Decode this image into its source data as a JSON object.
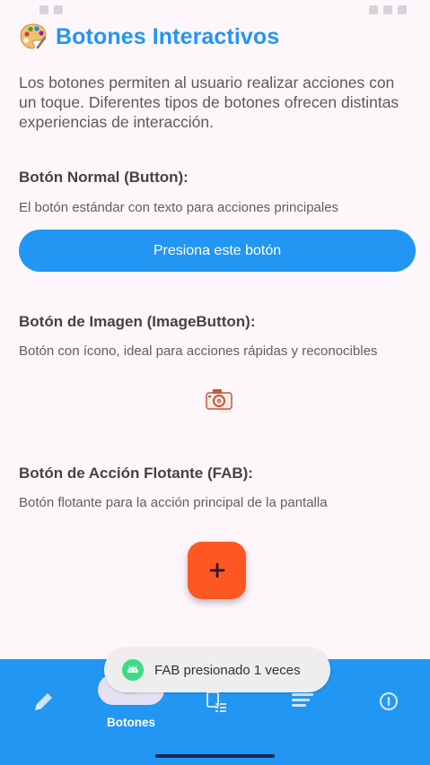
{
  "header": {
    "title": "Botones Interactivos"
  },
  "intro": "Los botones permiten al usuario realizar acciones con un toque. Diferentes tipos de botones ofrecen distintas experiencias de interacción.",
  "sections": {
    "normal": {
      "title": "Botón Normal (Button):",
      "description": "El botón estándar con texto para acciones principales",
      "button_label": "Presiona este botón"
    },
    "image": {
      "title": "Botón de Imagen (ImageButton):",
      "description": "Botón con ícono, ideal para acciones rápidas y reconocibles",
      "icon": "camera-icon"
    },
    "fab": {
      "title": "Botón de Acción Flotante (FAB):",
      "description": "Botón flotante para la acción principal de la pantalla",
      "icon": "plus-icon",
      "color": "#ff5722"
    }
  },
  "toast": {
    "text": "FAB presionado 1 veces",
    "icon": "android-icon"
  },
  "bottom_nav": {
    "items": [
      {
        "icon": "pencil-icon"
      },
      {
        "icon": "button-icon",
        "label": "Botones",
        "selected": true
      },
      {
        "icon": "list-doc-icon"
      },
      {
        "icon": "lines-icon"
      },
      {
        "icon": "info-icon"
      }
    ]
  },
  "colors": {
    "accent": "#2196f3",
    "background": "#fdf6fb",
    "fab": "#ff5722"
  }
}
